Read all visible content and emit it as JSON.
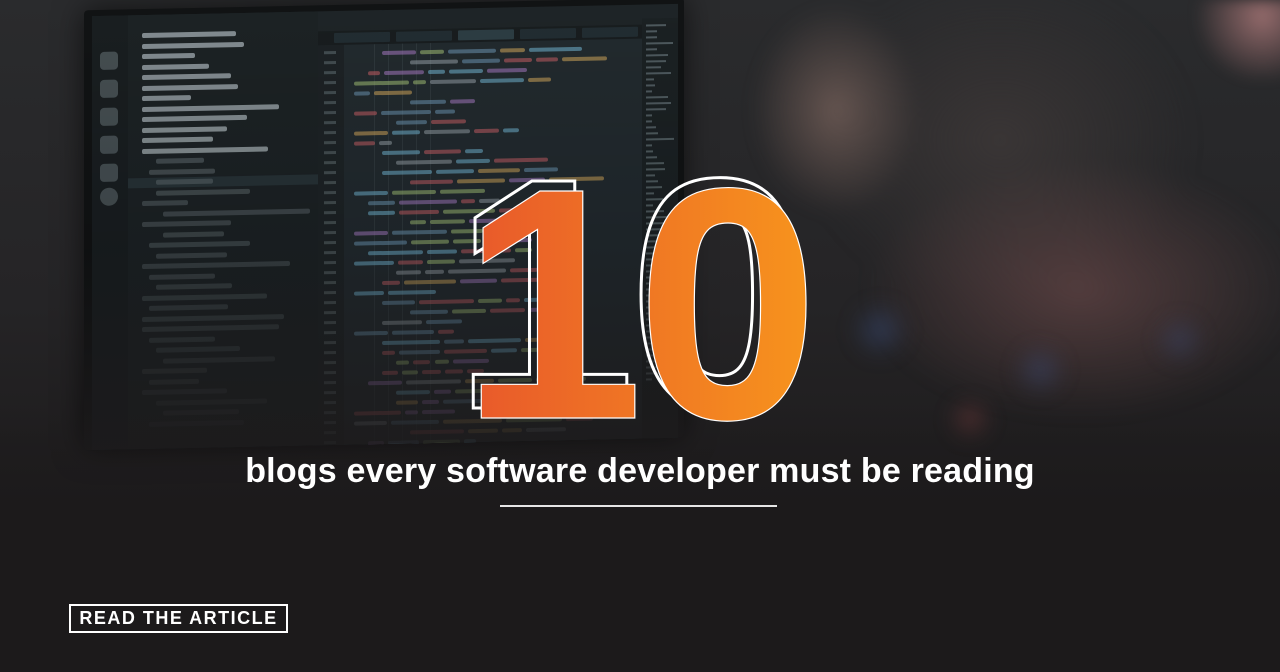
{
  "hero": {
    "number": "10",
    "tagline": "blogs every software developer must be reading"
  },
  "cta": {
    "label": "READ THE ARTICLE"
  },
  "colors": {
    "number_gradient_start": "#e8572b",
    "number_gradient_end": "#f7941d",
    "number_outline": "#ffffff",
    "text": "#ffffff",
    "background": "#1c1a1b"
  },
  "icons": {
    "monitor": "code-editor-monitor"
  }
}
